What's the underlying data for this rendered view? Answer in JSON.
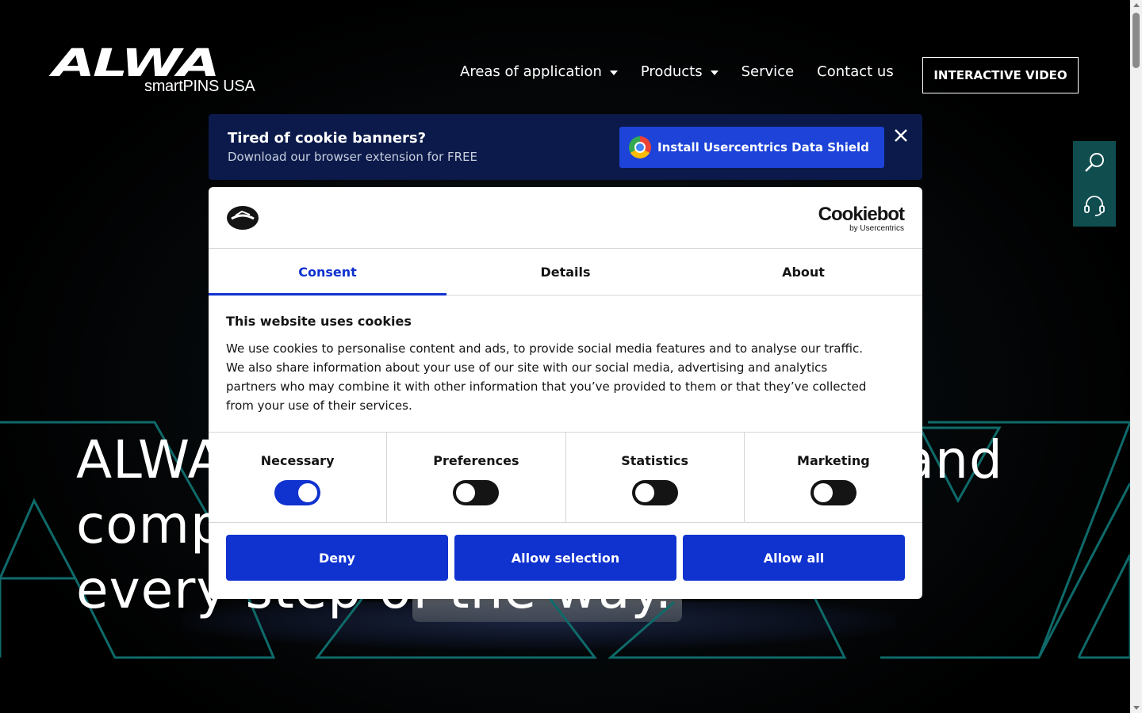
{
  "header": {
    "logo_main": "ALWA",
    "logo_sub": "smartPINS USA",
    "nav": [
      {
        "label": "Areas of application",
        "has_dropdown": true
      },
      {
        "label": "Products",
        "has_dropdown": true
      },
      {
        "label": "Service",
        "has_dropdown": false
      },
      {
        "label": "Contact us",
        "has_dropdown": false
      }
    ],
    "video_button": "INTERACTIVE VIDEO"
  },
  "side_tools": {
    "icons": [
      "search-icon",
      "headset-icon"
    ],
    "background": "#0f4d4f"
  },
  "hero": {
    "heading_line1_left": "ALWA",
    "heading_line1_right": "and",
    "heading_line2_left": "comp",
    "heading_line3": "every step of the way."
  },
  "uc_banner": {
    "title": "Tired of cookie banners?",
    "subtitle": "Download our browser extension for FREE",
    "install_label": "Install Usercentrics Data Shield",
    "colors": {
      "background": "#0b1a4a",
      "button": "#1d43d8"
    }
  },
  "cookie_dialog": {
    "brand_main": "Cookiebot",
    "brand_by": "by Usercentrics",
    "tabs": [
      {
        "label": "Consent",
        "active": true
      },
      {
        "label": "Details",
        "active": false
      },
      {
        "label": "About",
        "active": false
      }
    ],
    "title": "This website uses cookies",
    "body": "We use cookies to personalise content and ads, to provide social media features and to analyse our traffic. We also share information about your use of our site with our social media, advertising and analytics partners who may combine it with other information that you’ve provided to them or that they’ve collected from your use of their services.",
    "toggles": [
      {
        "label": "Necessary",
        "on": true
      },
      {
        "label": "Preferences",
        "on": false
      },
      {
        "label": "Statistics",
        "on": false
      },
      {
        "label": "Marketing",
        "on": false
      }
    ],
    "buttons": {
      "deny": "Deny",
      "allow_selection": "Allow selection",
      "allow_all": "Allow all"
    },
    "colors": {
      "accent": "#1032cf"
    }
  }
}
